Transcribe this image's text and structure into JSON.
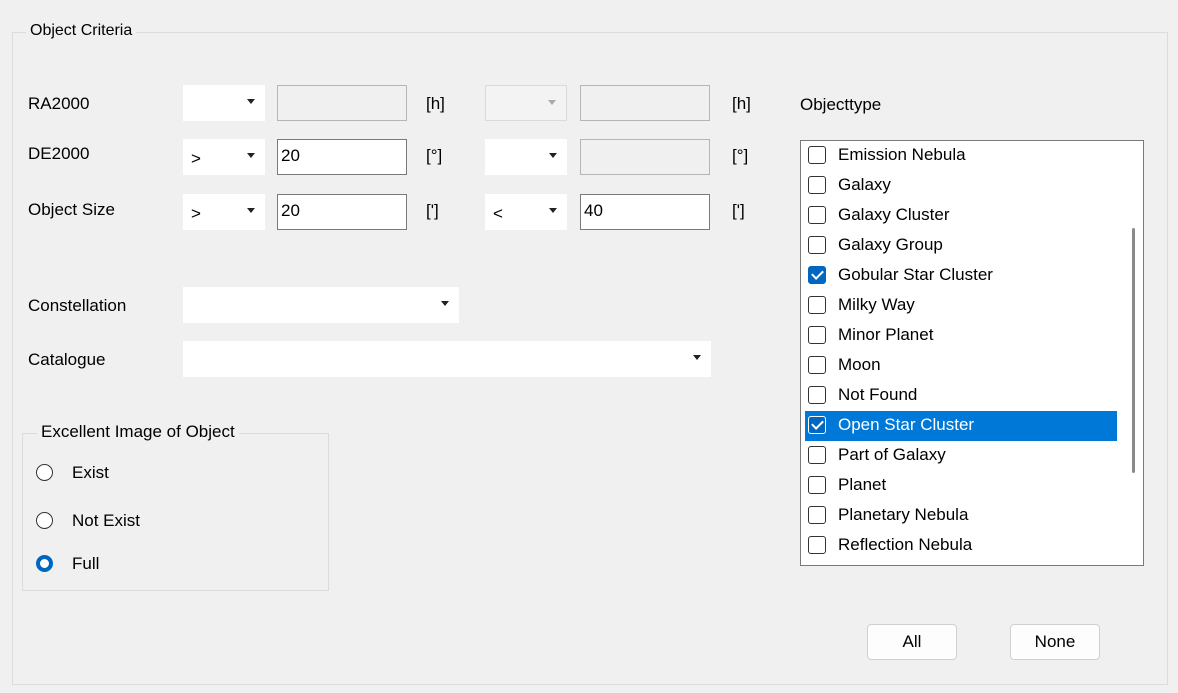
{
  "object_criteria": {
    "title": "Object Criteria",
    "ra": {
      "label": "RA2000",
      "op1": "",
      "value1": "",
      "unit1": "[h]",
      "op2": "",
      "value2": "",
      "unit2": "[h]"
    },
    "de": {
      "label": "DE2000",
      "op1": ">",
      "value1": "20",
      "unit1": "[°]",
      "op2": "",
      "value2": "",
      "unit2": "[°]"
    },
    "size": {
      "label": "Object Size",
      "op1": ">",
      "value1": "20",
      "unit1": "[']",
      "op2": "<",
      "value2": "40",
      "unit2": "[']"
    },
    "constellation": {
      "label": "Constellation",
      "value": ""
    },
    "catalogue": {
      "label": "Catalogue",
      "value": ""
    },
    "image_group": {
      "title": "Excellent Image of Object",
      "options": [
        {
          "label": "Exist",
          "selected": false
        },
        {
          "label": "Not Exist",
          "selected": false
        },
        {
          "label": "Full",
          "selected": true
        }
      ]
    },
    "objecttype": {
      "label": "Objecttype",
      "items": [
        {
          "label": "Emission Nebula",
          "checked": false,
          "highlighted": false
        },
        {
          "label": "Galaxy",
          "checked": false,
          "highlighted": false
        },
        {
          "label": "Galaxy Cluster",
          "checked": false,
          "highlighted": false
        },
        {
          "label": "Galaxy Group",
          "checked": false,
          "highlighted": false
        },
        {
          "label": "Gobular Star Cluster",
          "checked": true,
          "highlighted": false
        },
        {
          "label": "Milky Way",
          "checked": false,
          "highlighted": false
        },
        {
          "label": "Minor Planet",
          "checked": false,
          "highlighted": false
        },
        {
          "label": "Moon",
          "checked": false,
          "highlighted": false
        },
        {
          "label": "Not Found",
          "checked": false,
          "highlighted": false
        },
        {
          "label": "Open Star Cluster",
          "checked": true,
          "highlighted": true
        },
        {
          "label": "Part of Galaxy",
          "checked": false,
          "highlighted": false
        },
        {
          "label": "Planet",
          "checked": false,
          "highlighted": false
        },
        {
          "label": "Planetary Nebula",
          "checked": false,
          "highlighted": false
        },
        {
          "label": "Reflection Nebula",
          "checked": false,
          "highlighted": false
        }
      ]
    },
    "buttons": {
      "all": "All",
      "none": "None"
    }
  }
}
